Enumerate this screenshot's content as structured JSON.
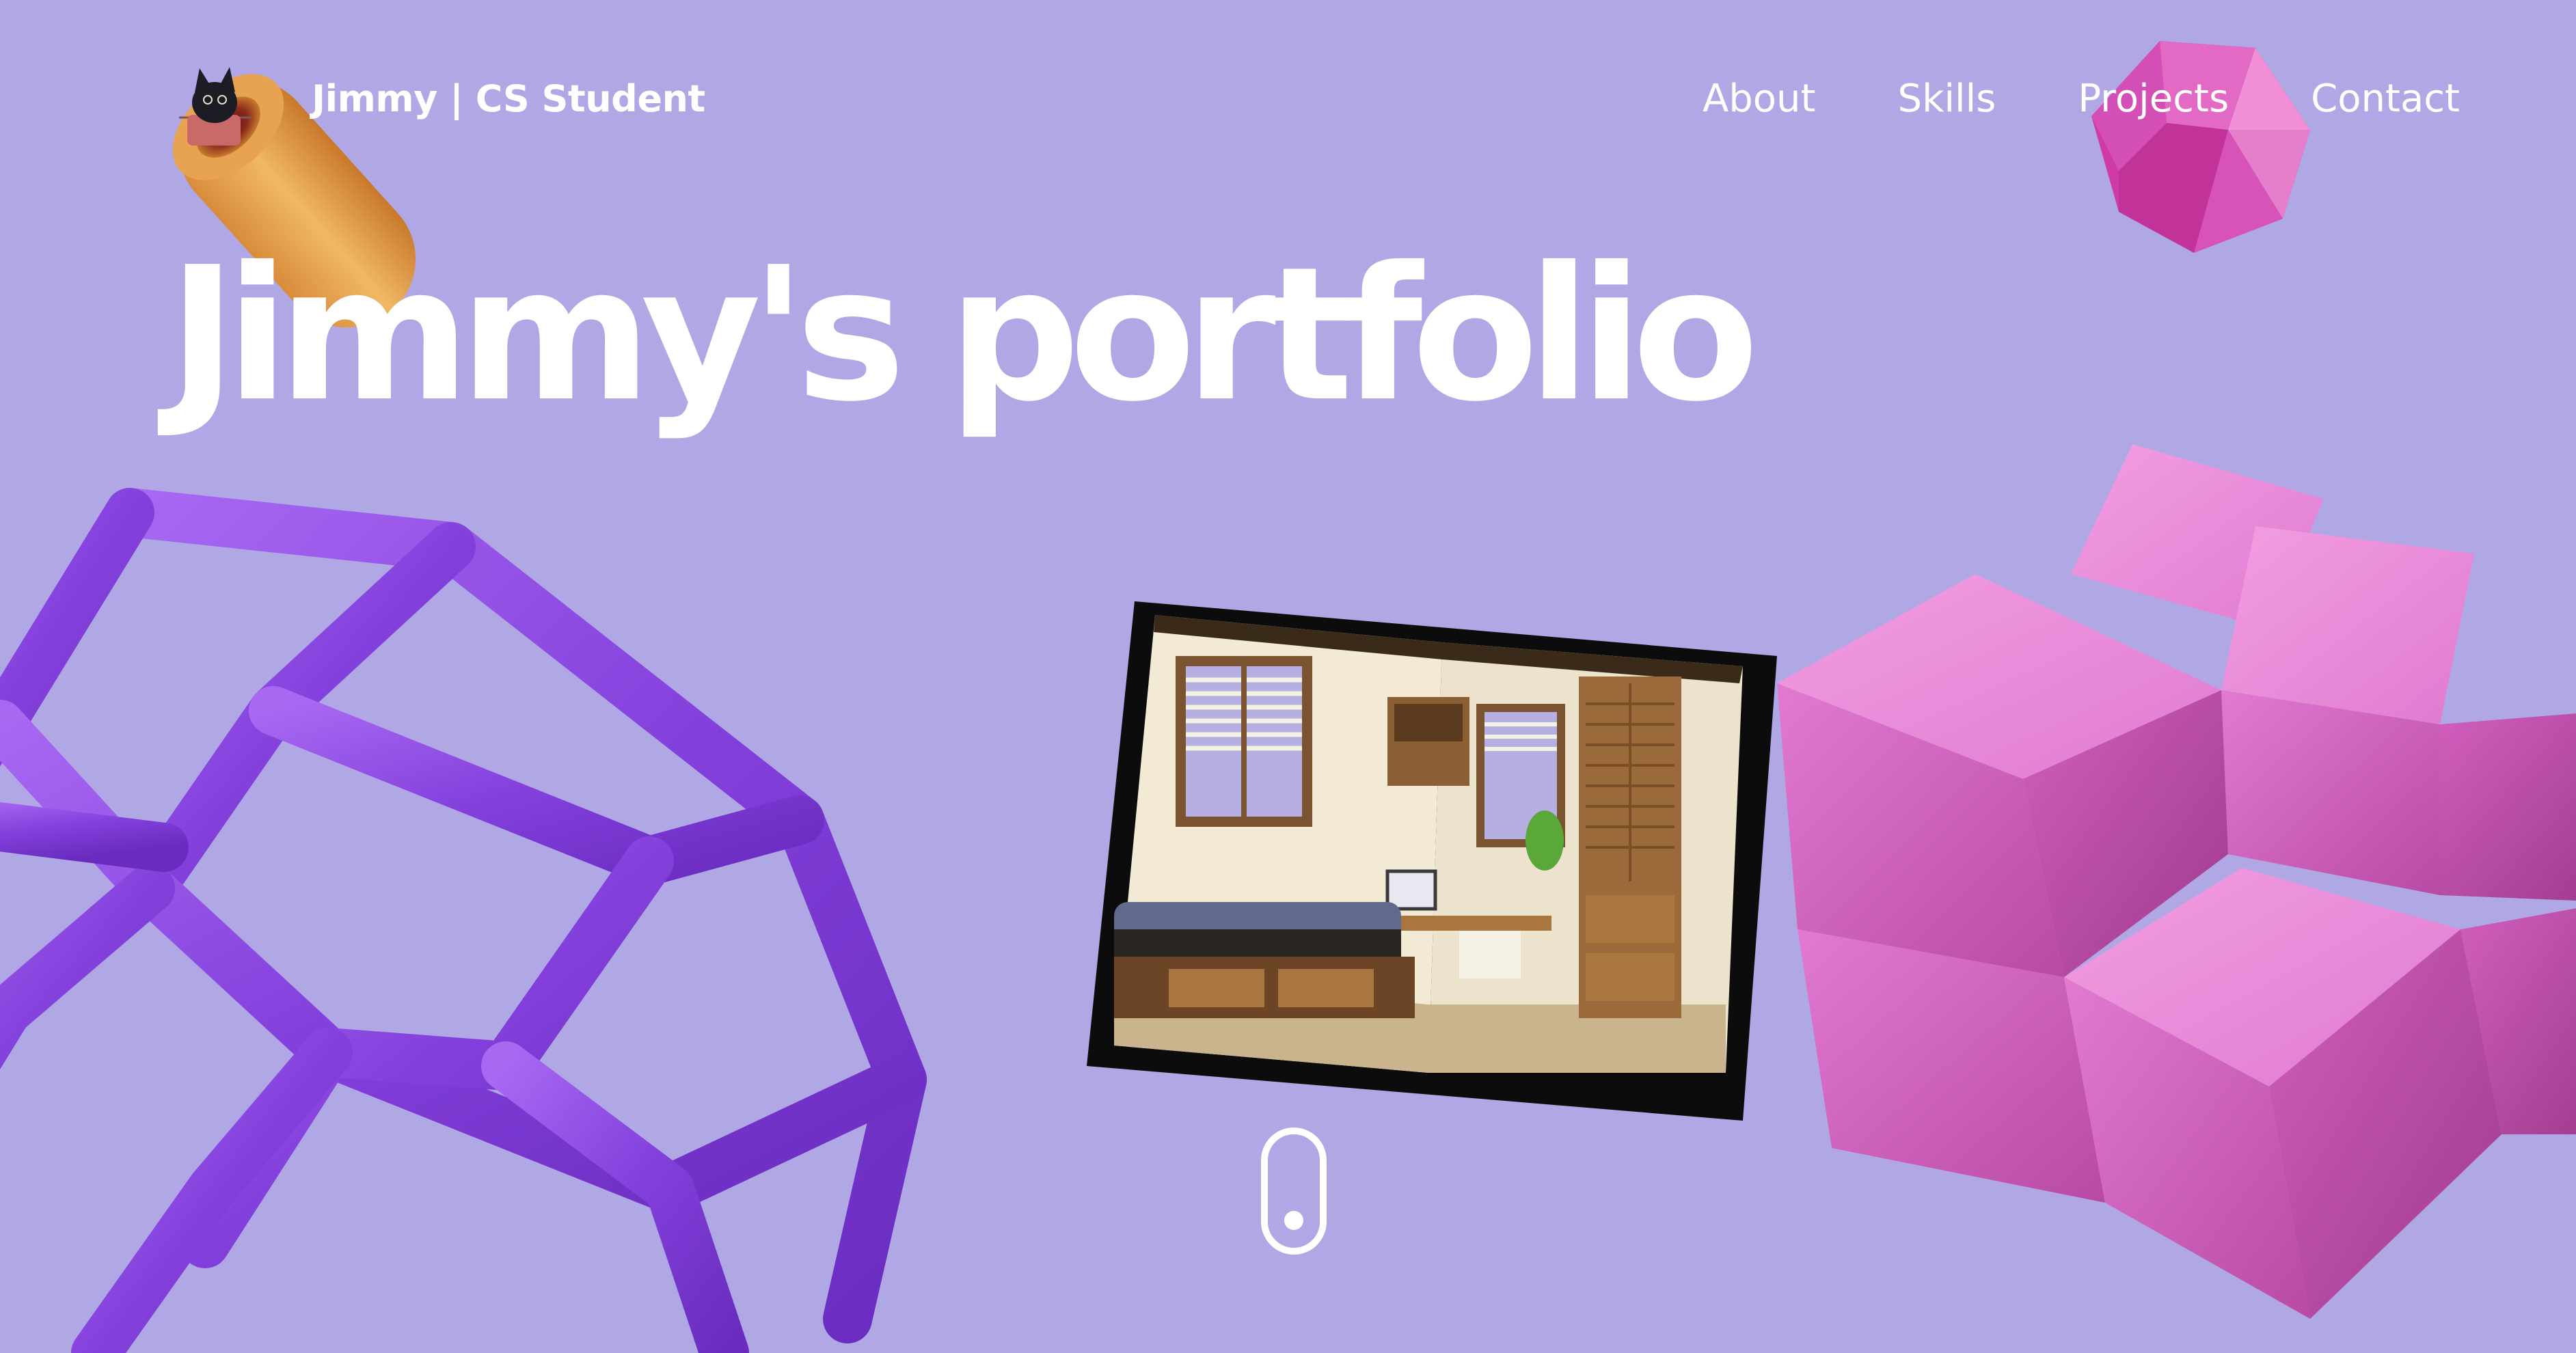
{
  "header": {
    "logo_icon": "cat-in-box-icon",
    "brand_name": "Jimmy",
    "brand_separator": "|",
    "brand_tagline": "CS Student",
    "nav": [
      {
        "label": "About"
      },
      {
        "label": "Skills"
      },
      {
        "label": "Projects"
      },
      {
        "label": "Contact"
      }
    ]
  },
  "hero": {
    "title": "Jimmy's portfolio"
  },
  "scroll_indicator": {
    "icon": "mouse-scroll-icon"
  },
  "colors": {
    "background": "#b0a8e4",
    "text": "#ffffff",
    "cage_purple": "#8a44e0",
    "cube_pink": "#d65ac4",
    "gem_magenta": "#d63fb4",
    "tube_orange": "#e0a04a"
  }
}
